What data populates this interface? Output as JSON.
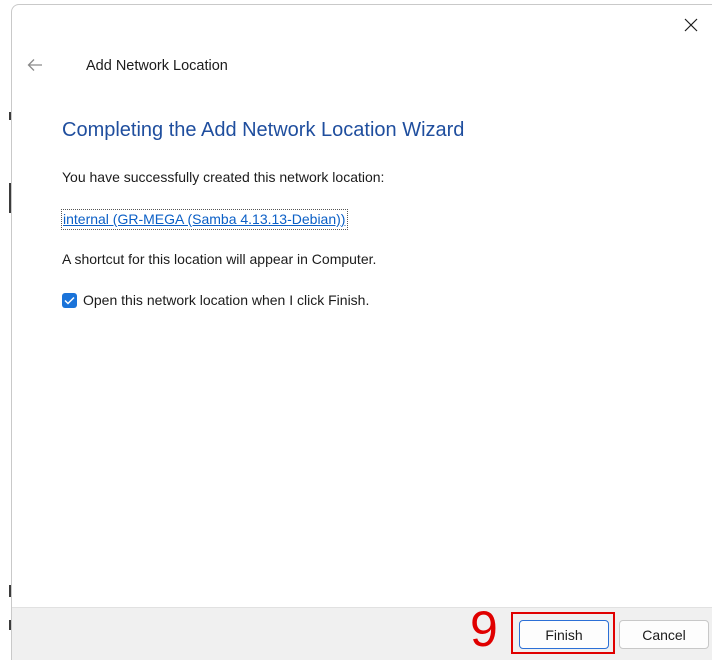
{
  "window": {
    "title": "Add Network Location",
    "close_icon": "close-icon",
    "back_icon": "back-arrow-icon"
  },
  "content": {
    "heading": "Completing the Add Network Location Wizard",
    "success_text": "You have successfully created this network location:",
    "location_link": "internal (GR-MEGA (Samba 4.13.13-Debian))",
    "shortcut_text": "A shortcut for this location will appear in Computer.",
    "open_checkbox": {
      "label": "Open this network location when I click Finish.",
      "checked": true
    }
  },
  "footer": {
    "finish_label": "Finish",
    "cancel_label": "Cancel"
  },
  "annotation": {
    "step_number": "9",
    "color": "#e00000"
  },
  "colors": {
    "heading": "#1f4e9e",
    "link": "#0b5fc6",
    "checkbox": "#1a73d9"
  }
}
